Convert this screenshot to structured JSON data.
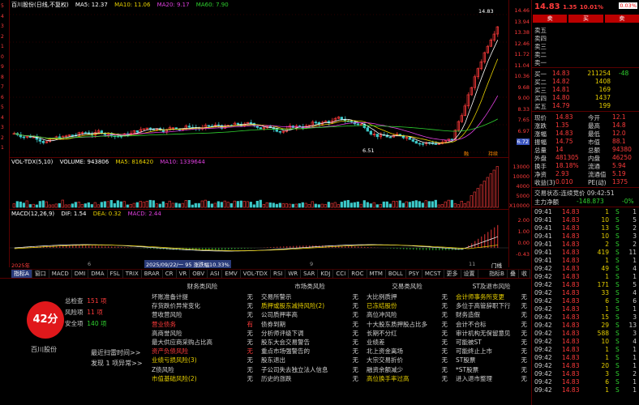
{
  "stock": {
    "name": "百川股份",
    "price": "14.83",
    "change": "1.35",
    "pct": "10.01%",
    "corner": "0.03%"
  },
  "chart": {
    "header_title": "百川股份(日线,不复权)",
    "ma": {
      "ma5": "MA5: 12.37",
      "ma10": "MA10: 11.06",
      "ma20": "MA20: 9.17",
      "ma60": "MA60: 7.90"
    },
    "vol_header": {
      "title": "VOL-TDX(5,10)",
      "volume": "VOLUME: 943806",
      "ma5": "MA5: 816420",
      "ma10": "MA10: 1339644"
    },
    "macd_header": {
      "title": "MACD(12,26,9)",
      "dif": "DIF: 1.54",
      "dea": "DEA: 0.32",
      "macd": "MACD: 2.44"
    },
    "high_label": "14.83",
    "low_label": "6.51",
    "flag_label": "6.72",
    "time_labels": [
      "2025年",
      "6",
      "7",
      "8",
      "9",
      "10",
      "11",
      "12",
      "2026年"
    ],
    "time_tooltip": "2025/09/22/一 95 涨跌幅10.33%",
    "right_buttons": [
      "门线"
    ],
    "markers": [
      "融",
      "持续"
    ]
  },
  "left_axis": [
    "5",
    "4",
    "3",
    "2",
    "1",
    "0",
    "9",
    "8",
    "7",
    "6",
    "5",
    "4",
    "3",
    "2",
    "1"
  ],
  "right_axis": {
    "price": [
      "14.46",
      "13.94",
      "13.38",
      "12.46",
      "11.72",
      "11.04",
      "10.36",
      "9.68",
      "9.00",
      "8.33",
      "7.65",
      "6.97",
      "6.30"
    ],
    "vol": [
      "13000",
      "10000",
      "4000",
      "5000",
      "X10000"
    ],
    "macd": [
      "2.00",
      "1.00",
      "0.00",
      "-0.43"
    ]
  },
  "tabs": [
    "指标A",
    "窗口",
    "MACD",
    "DMI",
    "DMA",
    "FSL",
    "TRIX",
    "BRAR",
    "CR",
    "VR",
    "OBV",
    "ASI",
    "EMV",
    "VOL-TDX",
    "RSI",
    "WR",
    "SAR",
    "KDJ",
    "CCI",
    "ROC",
    "MTM",
    "BOLL",
    "PSY",
    "MCST",
    "更多",
    "设置"
  ],
  "tabs_right": [
    "指标B",
    "叠",
    "收"
  ],
  "score": {
    "value": "42分",
    "name": "百川股份",
    "total_label": "总检查",
    "total_val": "151 项",
    "risk_label": "风险项",
    "risk_val": "11 项",
    "safe_label": "安全项",
    "safe_val": "140 项",
    "scan_link": "最近扫雷时间>>",
    "found": "发现 1 项异常>>"
  },
  "risk_columns": [
    {
      "header": "财务类风险",
      "rows": [
        {
          "label": "坏账准备计提",
          "status": "无",
          "color": "#d0d0d0"
        },
        {
          "label": "存货跌价异常变化",
          "status": "无",
          "color": "#d0d0d0"
        },
        {
          "label": "营收营风险",
          "status": "无",
          "color": "#d0d0d0"
        },
        {
          "label": "营业债务",
          "status": "有",
          "color": "#ff3b3b"
        },
        {
          "label": "高商誉风险",
          "status": "无",
          "color": "#d0d0d0"
        },
        {
          "label": "最大供应商采购占比高",
          "status": "无",
          "color": "#d0d0d0"
        },
        {
          "label": "资产负债风险",
          "status": "无",
          "color": "#ff3b3b"
        },
        {
          "label": "业绩亏损风险(3)",
          "status": "无",
          "color": "#e8d000"
        },
        {
          "label": "Z债风险",
          "status": "无",
          "color": "#d0d0d0"
        },
        {
          "label": "市值基础风险(2)",
          "status": "无",
          "color": "#e8d000"
        }
      ]
    },
    {
      "header": "市场类风险",
      "rows": [
        {
          "label": "交易所警示",
          "status": "无",
          "color": "#d0d0d0"
        },
        {
          "label": "质押或股东减持风险(2)",
          "status": "无",
          "color": "#e8d000"
        },
        {
          "label": "公司质押率高",
          "status": "无",
          "color": "#d0d0d0"
        },
        {
          "label": "债券到期",
          "status": "无",
          "color": "#d0d0d0"
        },
        {
          "label": "分析师评级下调",
          "status": "无",
          "color": "#d0d0d0"
        },
        {
          "label": "股东大会交易警告",
          "status": "无",
          "color": "#d0d0d0"
        },
        {
          "label": "重点市场强警告的",
          "status": "无",
          "color": "#d0d0d0"
        },
        {
          "label": "股东退出",
          "status": "无",
          "color": "#d0d0d0"
        },
        {
          "label": "子公司失去独立法人信息",
          "status": "无",
          "color": "#d0d0d0"
        },
        {
          "label": "历史的涨跌",
          "status": "无",
          "color": "#d0d0d0"
        }
      ]
    },
    {
      "header": "交易类风险",
      "rows": [
        {
          "label": "大比例质押",
          "status": "无",
          "color": "#d0d0d0"
        },
        {
          "label": "已冻结股份",
          "status": "无",
          "color": "#e8d000"
        },
        {
          "label": "高位冲风险",
          "status": "无",
          "color": "#d0d0d0"
        },
        {
          "label": "十大股东质押股占比多",
          "status": "无",
          "color": "#d0d0d0"
        },
        {
          "label": "长期不分红",
          "status": "无",
          "color": "#d0d0d0"
        },
        {
          "label": "业绩差",
          "status": "无",
          "color": "#d0d0d0"
        },
        {
          "label": "北上资金离场",
          "status": "无",
          "color": "#d0d0d0"
        },
        {
          "label": "大宗交易折价",
          "status": "无",
          "color": "#d0d0d0"
        },
        {
          "label": "融资余额减少",
          "status": "无",
          "color": "#d0d0d0"
        },
        {
          "label": "高位换手率过高",
          "status": "无",
          "color": "#e8d000"
        }
      ]
    },
    {
      "header": "ST及退市风险",
      "rows": [
        {
          "label": "会计师事务所变更",
          "status": "无",
          "color": "#e8d000"
        },
        {
          "label": "多位于高管辞职下行",
          "status": "无",
          "color": "#d0d0d0"
        },
        {
          "label": "财务造假",
          "status": "无",
          "color": "#d0d0d0"
        },
        {
          "label": "会计不合标",
          "status": "无",
          "color": "#d0d0d0"
        },
        {
          "label": "审计机构无保留意见",
          "status": "无",
          "color": "#d0d0d0"
        },
        {
          "label": "可能被ST",
          "status": "无",
          "color": "#d0d0d0"
        },
        {
          "label": "可能终止上市",
          "status": "无",
          "color": "#d0d0d0"
        },
        {
          "label": "ST股票",
          "status": "无",
          "color": "#d0d0d0"
        },
        {
          "label": "*ST股票",
          "status": "无",
          "color": "#d0d0d0"
        },
        {
          "label": "进入退市整理",
          "status": "无",
          "color": "#d0d0d0"
        }
      ]
    }
  ],
  "quote": {
    "top_bar": [
      "卖",
      "买",
      "卖"
    ],
    "asks": [
      {
        "label": "卖五",
        "price": "",
        "vol": ""
      },
      {
        "label": "卖四",
        "price": "",
        "vol": ""
      },
      {
        "label": "卖三",
        "price": "",
        "vol": ""
      },
      {
        "label": "卖二",
        "price": "",
        "vol": ""
      },
      {
        "label": "卖一",
        "price": "",
        "vol": ""
      }
    ],
    "bids": [
      {
        "label": "买一",
        "price": "14.83",
        "vol": "211254",
        "extra": "-48"
      },
      {
        "label": "买二",
        "price": "14.82",
        "vol": "1408",
        "extra": ""
      },
      {
        "label": "买三",
        "price": "14.81",
        "vol": "169",
        "extra": ""
      },
      {
        "label": "买四",
        "price": "14.80",
        "vol": "1437",
        "extra": ""
      },
      {
        "label": "买五",
        "price": "14.79",
        "vol": "199",
        "extra": ""
      }
    ],
    "stats": [
      {
        "k1": "现价",
        "v1": "14.83",
        "k2": "今开",
        "v2": "12.1"
      },
      {
        "k1": "涨跌",
        "v1": "1.35",
        "k2": "最高",
        "v2": "14.8"
      },
      {
        "k1": "涨幅",
        "v1": "14.83",
        "k2": "最低",
        "v2": "12.0"
      },
      {
        "k1": "振幅",
        "v1": "14.75",
        "k2": "市值",
        "v2": "88.1"
      },
      {
        "k1": "总量",
        "v1": "14",
        "k2": "总额",
        "v2": "94380"
      },
      {
        "k1": "外盘",
        "v1": "481305",
        "k2": "内盘",
        "v2": "46250"
      },
      {
        "k1": "换手",
        "v1": "18.18%",
        "k2": "流通",
        "v2": "5.94"
      },
      {
        "k1": "净资",
        "v1": "2.93",
        "k2": "流通值",
        "v2": "5.19"
      },
      {
        "k1": "收益(3)",
        "v1": "0.010",
        "k2": "PE(动)",
        "v2": "1375"
      }
    ],
    "status_line": "交易状态:连续竞价 09:42:51",
    "main_force": "主力净额",
    "main_force_val": "-148.873",
    "main_force_pct": "-0%",
    "ticks": [
      {
        "t": "09:41",
        "p": "14.83",
        "v": "1",
        "d": "S",
        "n": "1"
      },
      {
        "t": "09:41",
        "p": "14.83",
        "v": "10",
        "d": "S",
        "n": "5"
      },
      {
        "t": "09:41",
        "p": "14.83",
        "v": "13",
        "d": "S",
        "n": "2"
      },
      {
        "t": "09:41",
        "p": "14.83",
        "v": "10",
        "d": "S",
        "n": "3"
      },
      {
        "t": "09:41",
        "p": "14.83",
        "v": "2",
        "d": "S",
        "n": "2"
      },
      {
        "t": "09:41",
        "p": "14.83",
        "v": "419",
        "d": "S",
        "n": "11"
      },
      {
        "t": "09:41",
        "p": "14.83",
        "v": "1",
        "d": "S",
        "n": "1"
      },
      {
        "t": "09:42",
        "p": "14.83",
        "v": "49",
        "d": "S",
        "n": "4"
      },
      {
        "t": "09:42",
        "p": "14.83",
        "v": "1",
        "d": "S",
        "n": "1"
      },
      {
        "t": "09:42",
        "p": "14.83",
        "v": "171",
        "d": "S",
        "n": "5"
      },
      {
        "t": "09:42",
        "p": "14.83",
        "v": "33",
        "d": "S",
        "n": "4"
      },
      {
        "t": "09:42",
        "p": "14.83",
        "v": "6",
        "d": "S",
        "n": "6"
      },
      {
        "t": "09:42",
        "p": "14.83",
        "v": "1",
        "d": "S",
        "n": "1"
      },
      {
        "t": "09:42",
        "p": "14.83",
        "v": "15",
        "d": "S",
        "n": "3"
      },
      {
        "t": "09:42",
        "p": "14.83",
        "v": "29",
        "d": "S",
        "n": "13"
      },
      {
        "t": "09:42",
        "p": "14.83",
        "v": "588",
        "d": "S",
        "n": "3"
      },
      {
        "t": "09:42",
        "p": "14.83",
        "v": "10",
        "d": "S",
        "n": "4"
      },
      {
        "t": "09:42",
        "p": "14.83",
        "v": "1",
        "d": "S",
        "n": "1"
      },
      {
        "t": "09:42",
        "p": "14.83",
        "v": "1",
        "d": "S",
        "n": "1"
      },
      {
        "t": "09:42",
        "p": "14.83",
        "v": "20",
        "d": "S",
        "n": "1"
      },
      {
        "t": "09:42",
        "p": "14.83",
        "v": "3",
        "d": "S",
        "n": "2"
      },
      {
        "t": "09:42",
        "p": "14.83",
        "v": "6",
        "d": "S",
        "n": "1"
      },
      {
        "t": "09:42",
        "p": "14.83",
        "v": "1",
        "d": "S",
        "n": "1"
      }
    ]
  }
}
